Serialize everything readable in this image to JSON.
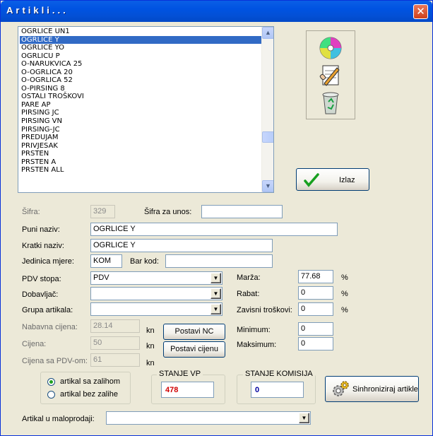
{
  "window": {
    "title": "Artikli...",
    "close_glyph": "✕"
  },
  "list": {
    "items": [
      "OGRLICE UN1",
      "OGRLICE Y",
      "OGRLICE YO",
      "OGRLICU P",
      "O-NARUKVICA 25",
      "O-OGRLICA 20",
      "O-OGRLICA 52",
      "O-PIRSING 8",
      "OSTALI TROŠKOVI",
      "PARE AP",
      "PIRSING JC",
      "PIRSING VN",
      "PIRSING-JC",
      "PREDUJAM",
      "PRIVJESAK",
      "PRSTEN",
      "PRSTEN A",
      "PRSTEN ALL"
    ],
    "selected_index": 1,
    "scroll_up": "▲",
    "scroll_down": "▼"
  },
  "icons": [
    "cd-save-icon",
    "notepad-edit-icon",
    "recycle-bin-icon"
  ],
  "exit_button": {
    "label": "Izlaz",
    "icon": "checkmark-icon"
  },
  "form": {
    "sifra_label": "Šifra:",
    "sifra_value": "329",
    "sifra_unos_label": "Šifra za unos:",
    "sifra_unos_value": "",
    "puni_naziv_label": "Puni naziv:",
    "puni_naziv_value": "OGRLICE Y",
    "kratki_naziv_label": "Kratki naziv:",
    "kratki_naziv_value": "OGRLICE Y",
    "jedinica_label": "Jedinica mjere:",
    "jedinica_value": "KOM",
    "barkod_label": "Bar kod:",
    "barkod_value": "",
    "pdv_label": "PDV stopa:",
    "pdv_value": "PDV",
    "dobavljac_label": "Dobavljač:",
    "dobavljac_value": "",
    "grupa_label": "Grupa artikala:",
    "grupa_value": "",
    "nabavna_label": "Nabavna cijena:",
    "nabavna_value": "28.14",
    "cijena_label": "Cijena:",
    "cijena_value": "50",
    "cijena_pdv_label": "Cijena sa PDV-om:",
    "cijena_pdv_value": "61",
    "kn": "kn",
    "postavi_nc": "Postavi NC",
    "postavi_cijenu": "Postavi cijenu",
    "marza_label": "Marža:",
    "marza_value": "77.68",
    "rabat_label": "Rabat:",
    "rabat_value": "0",
    "zavisni_label": "Zavisni troškovi:",
    "zavisni_value": "0",
    "pct": "%",
    "minimum_label": "Minimum:",
    "minimum_value": "0",
    "maksimum_label": "Maksimum:",
    "maksimum_value": "0",
    "radio_sa": "artikal sa zalihom",
    "radio_bez": "artikal bez zalihe",
    "stanje_vp_label": "STANJE VP",
    "stanje_vp_value": "478",
    "stanje_vp_color": "#d00000",
    "stanje_kom_label": "STANJE KOMISIJA",
    "stanje_kom_value": "0",
    "stanje_kom_color": "#0000a0",
    "sync_button": "Sinhroniziraj artikle",
    "maloprodaja_label": "Artikal u maloprodaji:",
    "maloprodaja_value": "",
    "dropdown_glyph": "▼"
  }
}
